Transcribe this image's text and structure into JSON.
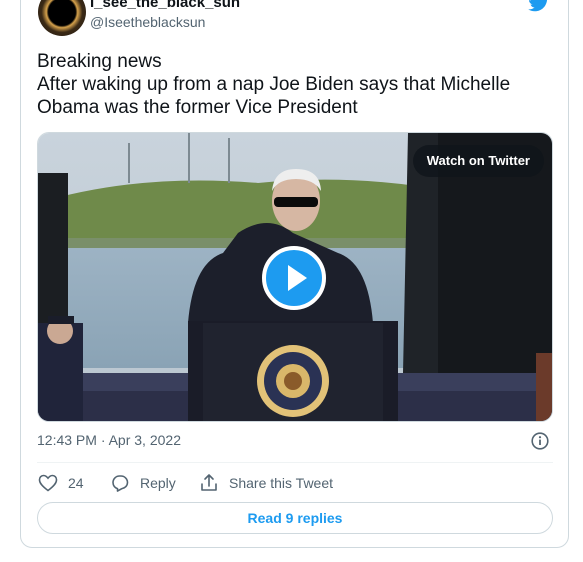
{
  "author": {
    "display_name": "I_see_the_black_sun",
    "handle": "@Iseetheblacksun"
  },
  "tweet": {
    "text_lines": [
      "Breaking news",
      "After waking up from a nap Joe Biden says that Michelle",
      "Obama was the former Vice President"
    ],
    "timestamp": "12:43 PM · Apr 3, 2022"
  },
  "media": {
    "watch_label": "Watch on Twitter"
  },
  "actions": {
    "like_count": "24",
    "reply_label": "Reply",
    "share_label": "Share this Tweet"
  },
  "footer": {
    "read_replies_label": "Read 9 replies"
  },
  "colors": {
    "accent": "#1d9bf0",
    "secondary_text": "#536471",
    "border": "#cfd9de"
  },
  "icons": [
    "twitter-bird-icon",
    "play-icon",
    "info-icon",
    "heart-icon",
    "reply-icon",
    "share-icon"
  ]
}
